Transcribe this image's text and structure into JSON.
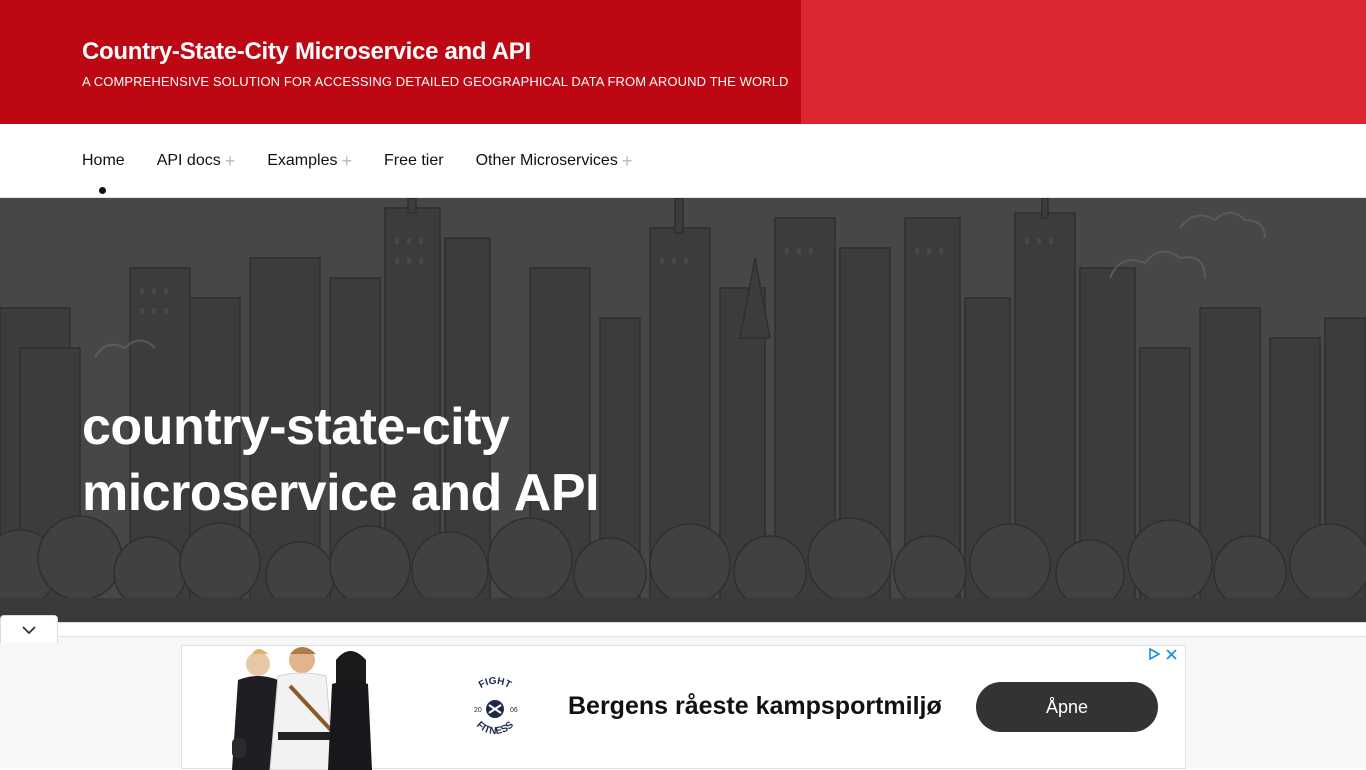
{
  "header": {
    "title": "Country-State-City Microservice and API",
    "tagline": "A COMPREHENSIVE SOLUTION FOR ACCESSING DETAILED GEOGRAPHICAL DATA FROM AROUND THE WORLD"
  },
  "nav": {
    "items": [
      {
        "label": "Home",
        "has_submenu": false,
        "active": true
      },
      {
        "label": "API docs",
        "has_submenu": true
      },
      {
        "label": "Examples",
        "has_submenu": true
      },
      {
        "label": "Free tier",
        "has_submenu": false
      },
      {
        "label": "Other Microservices",
        "has_submenu": true
      }
    ],
    "submenu_glyph": "+"
  },
  "hero": {
    "title_line1": "country-state-city",
    "title_line2": "microservice and API"
  },
  "ad": {
    "logo_top": "FIGHT",
    "logo_bottom": "FITNESS",
    "logo_year_left": "20",
    "logo_year_right": "06",
    "headline": "Bergens råeste kampsportmiljø",
    "cta": "Åpne"
  },
  "icons": {
    "collapse": "chevron-down-icon",
    "ad_info": "ad-choices-icon",
    "ad_close": "close-icon"
  },
  "colors": {
    "header_brand": "#bd0712",
    "header_accent": "#dc2630",
    "hero_bg": "#474747",
    "cta_bg": "#333333"
  }
}
